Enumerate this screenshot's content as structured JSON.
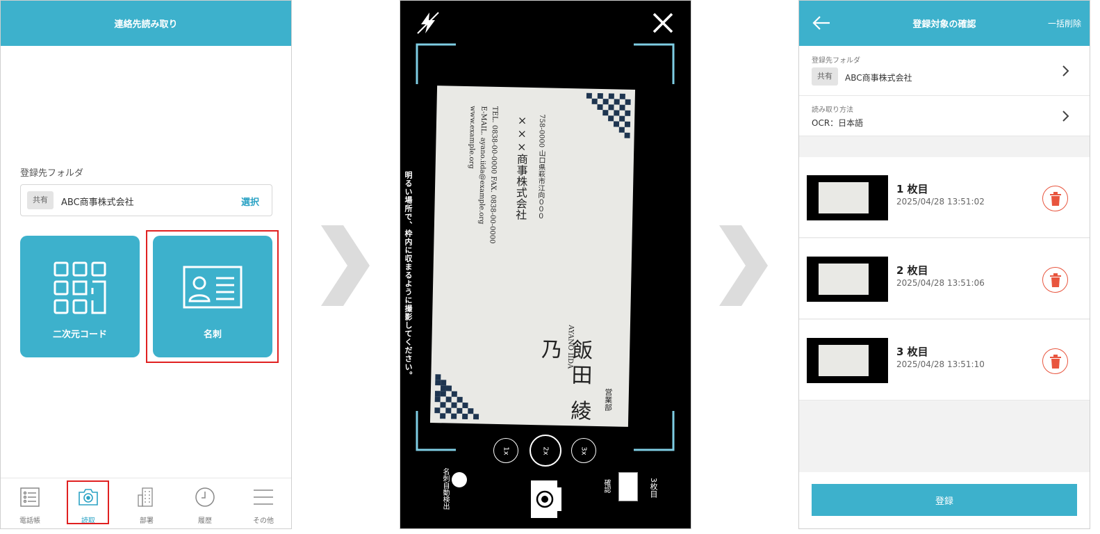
{
  "screen1": {
    "title": "連絡先読み取り",
    "folder_label": "登録先フォルダ",
    "folder_tag": "共有",
    "folder_name": "ABC商事株式会社",
    "select_label": "選択",
    "tile_qr_label": "二次元コード",
    "tile_card_label": "名刺",
    "tabs": [
      {
        "label": "電話帳",
        "icon": "list-icon"
      },
      {
        "label": "読取",
        "icon": "camera-icon"
      },
      {
        "label": "部署",
        "icon": "building-icon"
      },
      {
        "label": "履歴",
        "icon": "clock-icon"
      },
      {
        "label": "その他",
        "icon": "menu-icon"
      }
    ]
  },
  "screen2": {
    "hint": "明るい場所で、枠内に収まるように撮影してください。",
    "zoom_options": [
      "1x",
      "2x",
      "3x"
    ],
    "auto_detect_label": "名刺自動検出",
    "confirm_label": "確認",
    "count_label": "3枚目",
    "card": {
      "company": "×××商事株式会社",
      "address": "758-0000 山口県萩市江向０００",
      "tel": "TEL. 0838-00-0000   FAX. 0838-00-0000",
      "email": "E-MAIL. ayano.iida@example.org",
      "web": "www.example.org",
      "romaji": "AYANO IIDA",
      "name": "飯田 綾乃",
      "dept": "営業部"
    }
  },
  "screen3": {
    "title": "登録対象の確認",
    "bulk_delete": "一括削除",
    "folder_label": "登録先フォルダ",
    "folder_tag": "共有",
    "folder_name": "ABC商事株式会社",
    "method_label": "読み取り方法",
    "method_value": "OCR：日本語",
    "items": [
      {
        "title": "1 枚目",
        "date": "2025/04/28 13:51:02"
      },
      {
        "title": "2 枚目",
        "date": "2025/04/28 13:51:06"
      },
      {
        "title": "3 枚目",
        "date": "2025/04/28 13:51:10"
      }
    ],
    "submit_label": "登録"
  },
  "colors": {
    "accent": "#3db1cc",
    "highlight": "#e02020",
    "delete": "#e8553e"
  }
}
